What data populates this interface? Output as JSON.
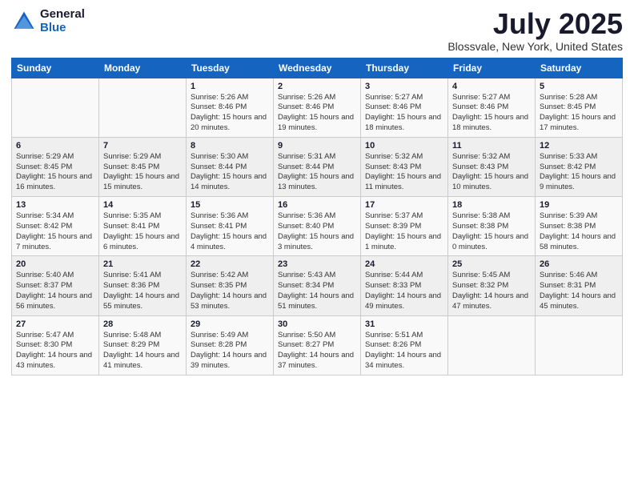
{
  "logo": {
    "general": "General",
    "blue": "Blue"
  },
  "header": {
    "title": "July 2025",
    "subtitle": "Blossvale, New York, United States"
  },
  "weekdays": [
    "Sunday",
    "Monday",
    "Tuesday",
    "Wednesday",
    "Thursday",
    "Friday",
    "Saturday"
  ],
  "weeks": [
    [
      {
        "day": "",
        "info": ""
      },
      {
        "day": "",
        "info": ""
      },
      {
        "day": "1",
        "info": "Sunrise: 5:26 AM\nSunset: 8:46 PM\nDaylight: 15 hours and 20 minutes."
      },
      {
        "day": "2",
        "info": "Sunrise: 5:26 AM\nSunset: 8:46 PM\nDaylight: 15 hours and 19 minutes."
      },
      {
        "day": "3",
        "info": "Sunrise: 5:27 AM\nSunset: 8:46 PM\nDaylight: 15 hours and 18 minutes."
      },
      {
        "day": "4",
        "info": "Sunrise: 5:27 AM\nSunset: 8:46 PM\nDaylight: 15 hours and 18 minutes."
      },
      {
        "day": "5",
        "info": "Sunrise: 5:28 AM\nSunset: 8:45 PM\nDaylight: 15 hours and 17 minutes."
      }
    ],
    [
      {
        "day": "6",
        "info": "Sunrise: 5:29 AM\nSunset: 8:45 PM\nDaylight: 15 hours and 16 minutes."
      },
      {
        "day": "7",
        "info": "Sunrise: 5:29 AM\nSunset: 8:45 PM\nDaylight: 15 hours and 15 minutes."
      },
      {
        "day": "8",
        "info": "Sunrise: 5:30 AM\nSunset: 8:44 PM\nDaylight: 15 hours and 14 minutes."
      },
      {
        "day": "9",
        "info": "Sunrise: 5:31 AM\nSunset: 8:44 PM\nDaylight: 15 hours and 13 minutes."
      },
      {
        "day": "10",
        "info": "Sunrise: 5:32 AM\nSunset: 8:43 PM\nDaylight: 15 hours and 11 minutes."
      },
      {
        "day": "11",
        "info": "Sunrise: 5:32 AM\nSunset: 8:43 PM\nDaylight: 15 hours and 10 minutes."
      },
      {
        "day": "12",
        "info": "Sunrise: 5:33 AM\nSunset: 8:42 PM\nDaylight: 15 hours and 9 minutes."
      }
    ],
    [
      {
        "day": "13",
        "info": "Sunrise: 5:34 AM\nSunset: 8:42 PM\nDaylight: 15 hours and 7 minutes."
      },
      {
        "day": "14",
        "info": "Sunrise: 5:35 AM\nSunset: 8:41 PM\nDaylight: 15 hours and 6 minutes."
      },
      {
        "day": "15",
        "info": "Sunrise: 5:36 AM\nSunset: 8:41 PM\nDaylight: 15 hours and 4 minutes."
      },
      {
        "day": "16",
        "info": "Sunrise: 5:36 AM\nSunset: 8:40 PM\nDaylight: 15 hours and 3 minutes."
      },
      {
        "day": "17",
        "info": "Sunrise: 5:37 AM\nSunset: 8:39 PM\nDaylight: 15 hours and 1 minute."
      },
      {
        "day": "18",
        "info": "Sunrise: 5:38 AM\nSunset: 8:38 PM\nDaylight: 15 hours and 0 minutes."
      },
      {
        "day": "19",
        "info": "Sunrise: 5:39 AM\nSunset: 8:38 PM\nDaylight: 14 hours and 58 minutes."
      }
    ],
    [
      {
        "day": "20",
        "info": "Sunrise: 5:40 AM\nSunset: 8:37 PM\nDaylight: 14 hours and 56 minutes."
      },
      {
        "day": "21",
        "info": "Sunrise: 5:41 AM\nSunset: 8:36 PM\nDaylight: 14 hours and 55 minutes."
      },
      {
        "day": "22",
        "info": "Sunrise: 5:42 AM\nSunset: 8:35 PM\nDaylight: 14 hours and 53 minutes."
      },
      {
        "day": "23",
        "info": "Sunrise: 5:43 AM\nSunset: 8:34 PM\nDaylight: 14 hours and 51 minutes."
      },
      {
        "day": "24",
        "info": "Sunrise: 5:44 AM\nSunset: 8:33 PM\nDaylight: 14 hours and 49 minutes."
      },
      {
        "day": "25",
        "info": "Sunrise: 5:45 AM\nSunset: 8:32 PM\nDaylight: 14 hours and 47 minutes."
      },
      {
        "day": "26",
        "info": "Sunrise: 5:46 AM\nSunset: 8:31 PM\nDaylight: 14 hours and 45 minutes."
      }
    ],
    [
      {
        "day": "27",
        "info": "Sunrise: 5:47 AM\nSunset: 8:30 PM\nDaylight: 14 hours and 43 minutes."
      },
      {
        "day": "28",
        "info": "Sunrise: 5:48 AM\nSunset: 8:29 PM\nDaylight: 14 hours and 41 minutes."
      },
      {
        "day": "29",
        "info": "Sunrise: 5:49 AM\nSunset: 8:28 PM\nDaylight: 14 hours and 39 minutes."
      },
      {
        "day": "30",
        "info": "Sunrise: 5:50 AM\nSunset: 8:27 PM\nDaylight: 14 hours and 37 minutes."
      },
      {
        "day": "31",
        "info": "Sunrise: 5:51 AM\nSunset: 8:26 PM\nDaylight: 14 hours and 34 minutes."
      },
      {
        "day": "",
        "info": ""
      },
      {
        "day": "",
        "info": ""
      }
    ]
  ]
}
